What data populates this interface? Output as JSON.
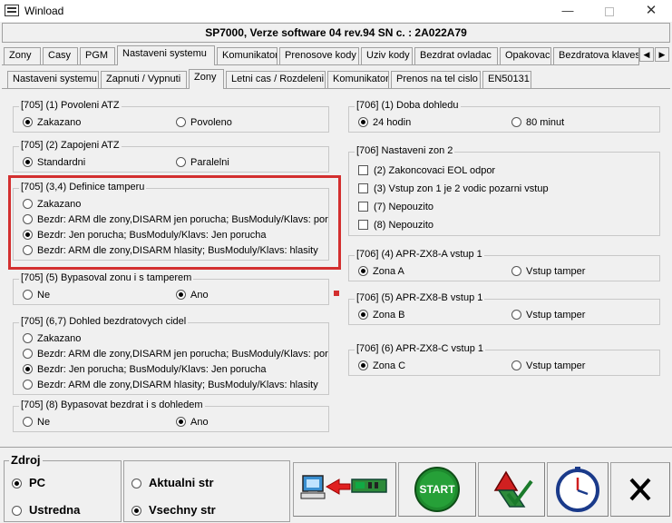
{
  "window": {
    "title": "Winload"
  },
  "header": {
    "text": "SP7000, Verze software 04 rev.94 SN c. : 2A022A79"
  },
  "main_tabs": [
    "Zony",
    "Casy",
    "PGM",
    "Nastaveni systemu",
    "Komunikator",
    "Prenosove kody",
    "Uziv kody",
    "Bezdrat ovladac",
    "Opakovac",
    "Bezdratova klavesn"
  ],
  "sub_tabs": [
    "Nastaveni systemu",
    "Zapnuti / Vypnuti",
    "Zony",
    "Letni cas / Rozdeleni",
    "Komunikator",
    "Prenos na tel cislo",
    "EN50131"
  ],
  "left_groups": {
    "g1": {
      "title": "[705] (1)  Povoleni ATZ",
      "opt1": "Zakazano",
      "opt2": "Povoleno"
    },
    "g2": {
      "title": "[705] (2)  Zapojeni ATZ",
      "opt1": "Standardni",
      "opt2": "Paralelni"
    },
    "g3": {
      "title": "[705]  (3,4)  Definice tamperu",
      "opt1": "Zakazano",
      "opt2": "Bezdr: ARM dle zony,DISARM jen porucha; BusModuly/Klavs: poruch",
      "opt3": "Bezdr: Jen porucha; BusModuly/Klavs: Jen porucha",
      "opt4": "Bezdr: ARM dle zony,DISARM hlasity; BusModuly/Klavs: hlasity"
    },
    "g4": {
      "title": "[705] (5)  Bypasoval zonu i s tamperem",
      "opt1": "Ne",
      "opt2": "Ano"
    },
    "g5": {
      "title": "[705]  (6,7)  Dohled bezdratovych cidel",
      "opt1": "Zakazano",
      "opt2": "Bezdr: ARM dle zony,DISARM jen porucha; BusModuly/Klavs: poruch",
      "opt3": "Bezdr: Jen porucha; BusModuly/Klavs: Jen porucha",
      "opt4": "Bezdr: ARM dle zony,DISARM hlasity; BusModuly/Klavs: hlasity"
    },
    "g6": {
      "title": "[705] (8)  Bypasovat bezdrat i s dohledem",
      "opt1": "Ne",
      "opt2": "Ano"
    }
  },
  "right_groups": {
    "g1": {
      "title": "[706] (1)  Doba dohledu",
      "opt1": "24 hodin",
      "opt2": "80 minut"
    },
    "g2": {
      "title": "[706]  Nastaveni zon 2",
      "opt1": "(2) Zakoncovaci EOL odpor",
      "opt2": "(3)  Vstup zon 1 je 2 vodic pozarni vstup",
      "opt3": "(7) Nepouzito",
      "opt4": "(8) Nepouzito"
    },
    "g3": {
      "title": "[706] (4)  APR-ZX8-A vstup  1",
      "opt1": "Zona A",
      "opt2": "Vstup tamper"
    },
    "g4": {
      "title": "[706] (5)  APR-ZX8-B vstup  1",
      "opt1": "Zona B",
      "opt2": "Vstup tamper"
    },
    "g5": {
      "title": "[706] (6)  APR-ZX8-C vstup  1",
      "opt1": "Zona C",
      "opt2": "Vstup tamper"
    }
  },
  "bottom": {
    "zdroj_title": "Zdroj",
    "zdroj_pc": "PC",
    "zdroj_ustredna": "Ustredna",
    "aktualni": "Aktualni str",
    "vsechny": "Vsechny str",
    "start_label": "START"
  },
  "colors": {
    "highlight": "#d32f2f",
    "start_green": "#1e8a2e"
  }
}
